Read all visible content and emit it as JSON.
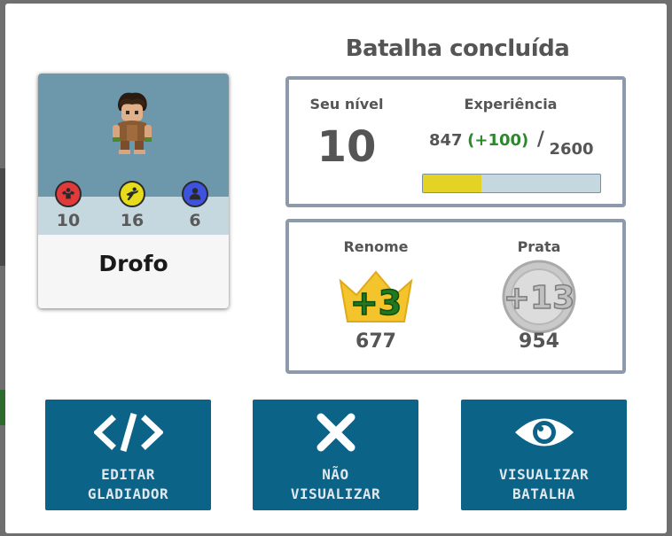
{
  "modal": {
    "title": "Batalha concluída"
  },
  "gladiator": {
    "name": "Drofo",
    "avatar_icon": "gladiator-avatar-icon",
    "stats": [
      {
        "icon": "strength-icon",
        "color": "#e23a3a",
        "value": "10"
      },
      {
        "icon": "agility-icon",
        "color": "#e6dc1a",
        "value": "16"
      },
      {
        "icon": "intelligence-icon",
        "color": "#3d53e0",
        "value": "6"
      }
    ]
  },
  "level": {
    "label": "Seu nível",
    "value": "10"
  },
  "experience": {
    "label": "Experiência",
    "current": "847",
    "gain": "(+100)",
    "separator": "/",
    "max": "2600",
    "progress": 0.33,
    "fill_color": "#e3d324"
  },
  "rewards": {
    "renown": {
      "label": "Renome",
      "gain": "+3",
      "value": "677",
      "icon": "crown-icon"
    },
    "silver": {
      "label": "Prata",
      "gain": "+13",
      "value": "954",
      "icon": "silver-coin-icon"
    }
  },
  "actions": [
    {
      "label": "EDITAR\nGLADIADOR",
      "icon": "code-icon"
    },
    {
      "label": "NÃO\nVISUALIZAR",
      "icon": "close-icon"
    },
    {
      "label": "VISUALIZAR\nBATALHA",
      "icon": "eye-icon"
    }
  ],
  "colors": {
    "button_bg": "#0c6388",
    "panel_border": "#8d9aab",
    "card_top": "#6d97ab",
    "card_stats": "#c5d8df",
    "gain_green": "#2a8a2a"
  }
}
